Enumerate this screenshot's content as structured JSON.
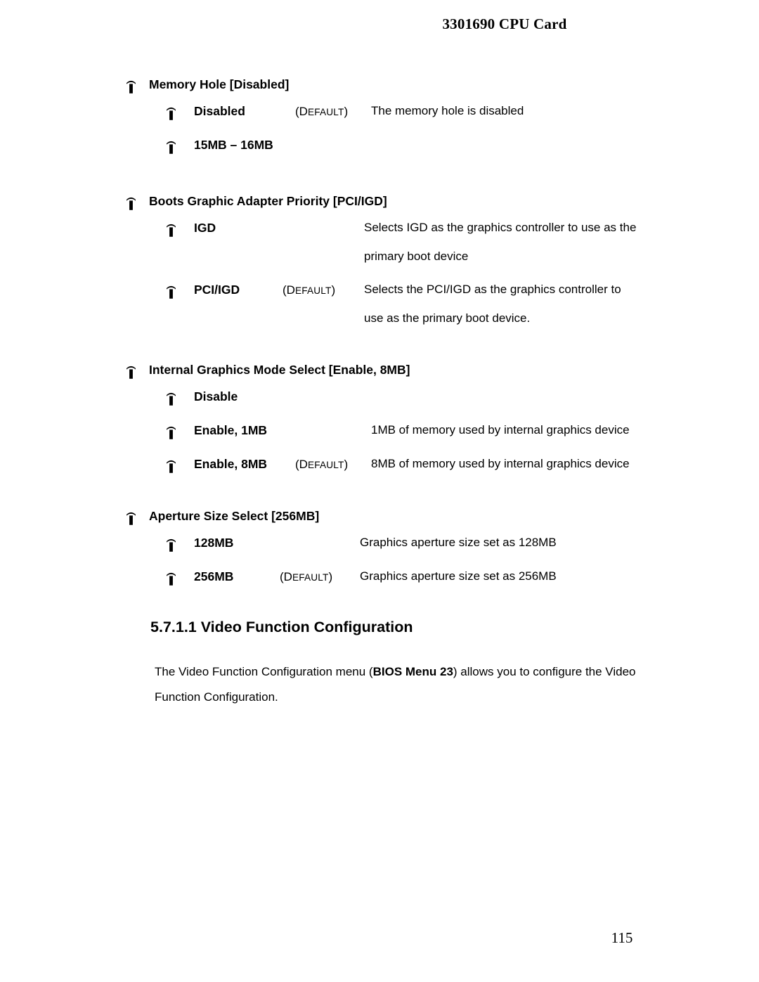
{
  "header": {
    "title": "3301690 CPU Card"
  },
  "footer": {
    "page_number": "115"
  },
  "bullet_icon": "pushpin-bullet-icon",
  "default_marker": {
    "open_paren": "(",
    "cap": "D",
    "rest": "EFAULT",
    "close_paren": ")"
  },
  "options": [
    {
      "title": "Memory Hole [Disabled]",
      "items": [
        {
          "label": "Disabled",
          "default": true,
          "desc_line1": "The memory hole is disabled",
          "desc_line2": ""
        },
        {
          "label": "15MB – 16MB",
          "default": false,
          "desc_line1": "",
          "desc_line2": ""
        }
      ]
    },
    {
      "title": "Boots Graphic Adapter Priority [PCI/IGD]",
      "items": [
        {
          "label": "IGD",
          "default": false,
          "desc_line1": "Selects IGD as the graphics controller to use as the",
          "desc_line2": "primary boot device"
        },
        {
          "label": "PCI/IGD",
          "default": true,
          "desc_line1": "Selects the PCI/IGD as the graphics controller to",
          "desc_line2": "use as the primary boot device."
        }
      ]
    },
    {
      "title": "Internal Graphics Mode Select [Enable, 8MB]",
      "items": [
        {
          "label": "Disable",
          "default": false,
          "desc_line1": "",
          "desc_line2": ""
        },
        {
          "label": "Enable, 1MB",
          "default": false,
          "desc_line1": "1MB of memory used by internal graphics device",
          "desc_line2": ""
        },
        {
          "label": "Enable, 8MB",
          "default": true,
          "desc_line1": "8MB of memory used by internal graphics device",
          "desc_line2": ""
        }
      ]
    },
    {
      "title": "Aperture Size Select [256MB]",
      "items": [
        {
          "label": "128MB",
          "default": false,
          "desc_line1": "Graphics aperture size set as 128MB",
          "desc_line2": ""
        },
        {
          "label": "256MB",
          "default": true,
          "desc_line1": "Graphics aperture size set as 256MB",
          "desc_line2": ""
        }
      ]
    }
  ],
  "section": {
    "heading": "5.7.1.1 Video Function Configuration",
    "paragraph_part1": "The Video Function Configuration menu (",
    "paragraph_bold": "BIOS Menu 23",
    "paragraph_part2": ") allows you to configure the Video Function Configuration."
  }
}
